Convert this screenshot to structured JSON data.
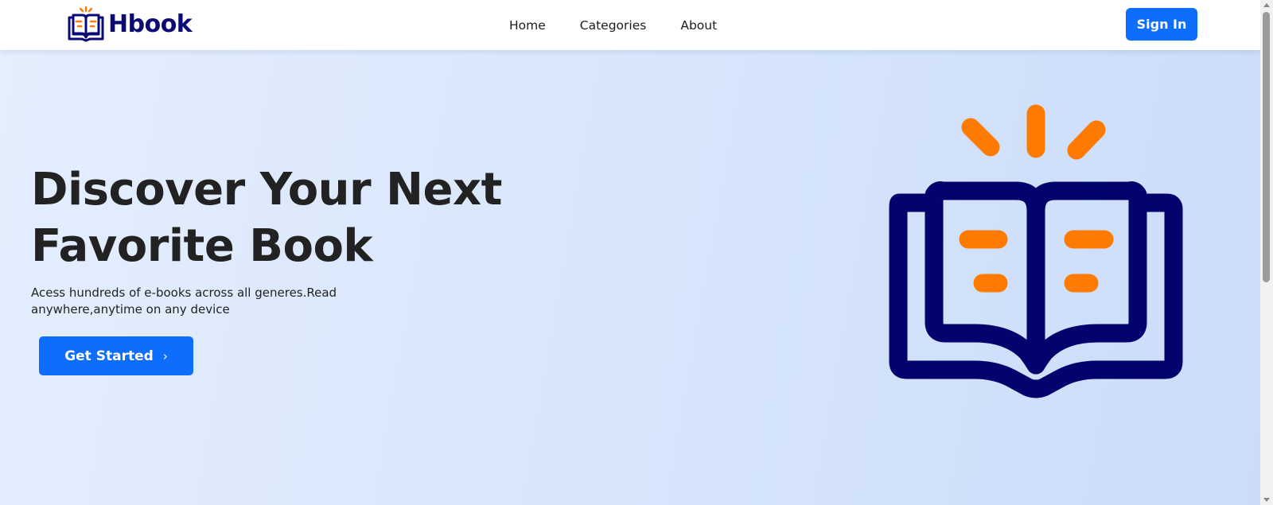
{
  "navbar": {
    "brand_name": "Hbook",
    "logo_icon": "open-book-icon",
    "links": [
      {
        "label": "Home"
      },
      {
        "label": "Categories"
      },
      {
        "label": "About"
      }
    ],
    "signin_label": "Sign In"
  },
  "hero": {
    "title_line1": "Discover Your Next",
    "title_line2": "Favorite Book",
    "subtitle": "Acess hundreds of e-books across all generes.Read anywhere,anytime on any device",
    "cta_label": "Get Started",
    "cta_icon": "chevron-right-icon",
    "illustration_icon": "open-book-icon"
  },
  "colors": {
    "brand_navy": "#0a0a78",
    "accent_orange": "#ff7a00",
    "primary_blue": "#0d6efd",
    "hero_bg": "#dbe7fc"
  }
}
